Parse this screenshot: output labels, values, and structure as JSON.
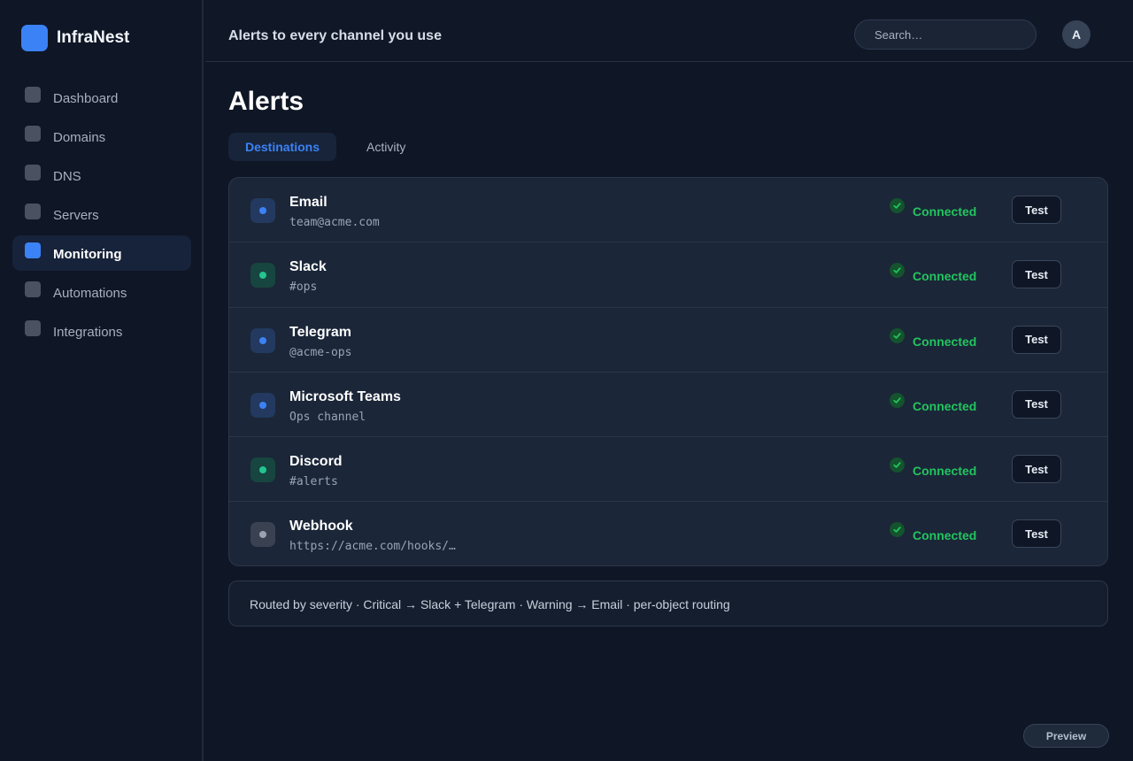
{
  "app": {
    "name": "InfraNest"
  },
  "sidebar": {
    "items": [
      {
        "label": "Dashboard",
        "active": false,
        "icon": "dashboard-icon"
      },
      {
        "label": "Domains",
        "active": false,
        "icon": "domains-icon"
      },
      {
        "label": "DNS",
        "active": false,
        "icon": "dns-icon"
      },
      {
        "label": "Servers",
        "active": false,
        "icon": "servers-icon"
      },
      {
        "label": "Monitoring",
        "active": true,
        "icon": "monitoring-icon"
      },
      {
        "label": "Automations",
        "active": false,
        "icon": "automations-icon"
      },
      {
        "label": "Integrations",
        "active": false,
        "icon": "integrations-icon"
      }
    ]
  },
  "header": {
    "title": "Alerts to every channel you use",
    "search_placeholder": "Search…",
    "avatar_initial": "A"
  },
  "main": {
    "title": "Alerts",
    "tabs": [
      {
        "label": "Destinations",
        "active": true
      },
      {
        "label": "Activity",
        "active": false
      }
    ],
    "destinations": [
      {
        "name": "Email",
        "detail": "team@acme.com",
        "status": "Connected",
        "action": "Test",
        "icon_bg": "#23395f",
        "icon_dot": "#3b82f6"
      },
      {
        "name": "Slack",
        "detail": "#ops",
        "status": "Connected",
        "action": "Test",
        "icon_bg": "#17453f",
        "icon_dot": "#22c58e"
      },
      {
        "name": "Telegram",
        "detail": "@acme-ops",
        "status": "Connected",
        "action": "Test",
        "icon_bg": "#23395f",
        "icon_dot": "#3b82f6"
      },
      {
        "name": "Microsoft Teams",
        "detail": "Ops channel",
        "status": "Connected",
        "action": "Test",
        "icon_bg": "#23395f",
        "icon_dot": "#3b82f6"
      },
      {
        "name": "Discord",
        "detail": "#alerts",
        "status": "Connected",
        "action": "Test",
        "icon_bg": "#17453f",
        "icon_dot": "#22c58e"
      },
      {
        "name": "Webhook",
        "detail": "https://acme.com/hooks/…",
        "status": "Connected",
        "action": "Test",
        "icon_bg": "#3a4252",
        "icon_dot": "#9aa3b1"
      }
    ],
    "routing_note": "Routed by severity · Critical → Slack + Telegram · Warning → Email · per-object routing"
  },
  "footer": {
    "preview_label": "Preview"
  },
  "colors": {
    "accent": "#3b82f6",
    "success": "#22c55e",
    "background": "#0f1625",
    "panel": "#1b2638"
  }
}
